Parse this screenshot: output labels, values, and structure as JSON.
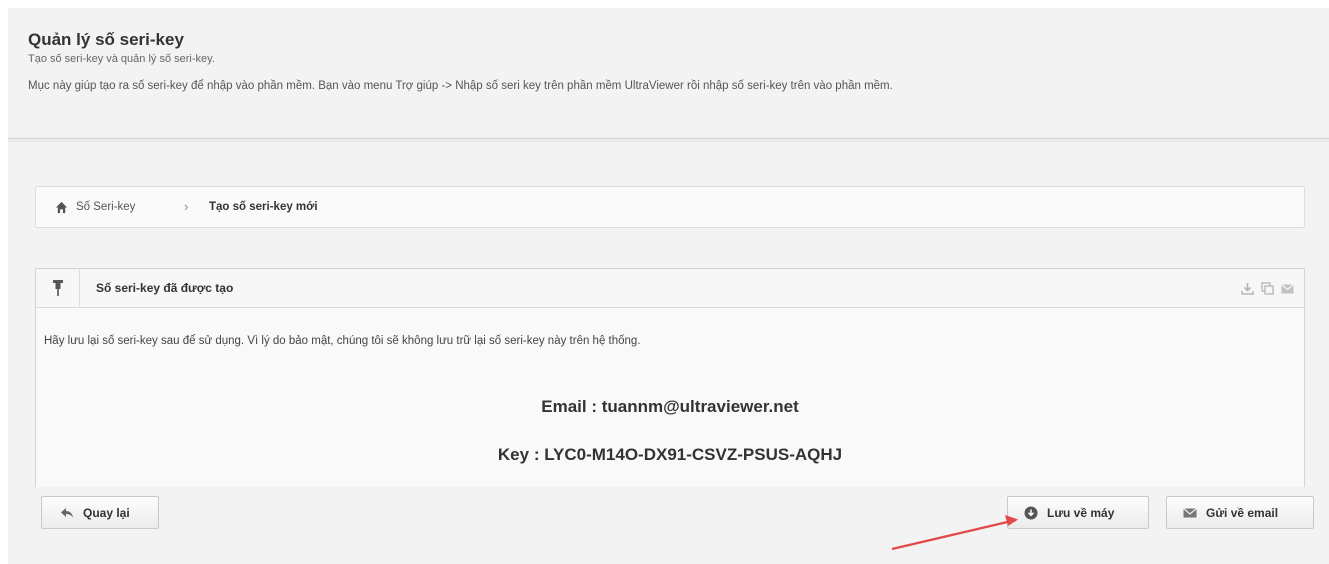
{
  "header": {
    "title": "Quản lý số seri-key",
    "subtitle": "Tạo số seri-key và quản lý số seri-key.",
    "description": "Mục này giúp tạo ra số seri-key để nhập vào phần mềm. Bạn vào menu Trợ giúp -> Nhập số seri key trên phần mềm UltraViewer rồi nhập số seri-key trên vào phần mềm."
  },
  "breadcrumb": {
    "home_icon": "home-icon",
    "item": "Số Seri-key",
    "separator": "›",
    "current": "Tạo số seri-key mới"
  },
  "widget": {
    "icon": "pin-icon",
    "title": "Số seri-key đã được tạo",
    "tools": [
      "download-icon",
      "copy-icon",
      "mail-icon"
    ],
    "notice": "Hãy lưu lại số seri-key sau để sử dụng. Vì lý do bảo mật, chúng tôi sẽ không lưu trữ lại số seri-key này trên hệ thống.",
    "email_line": "Email : tuannm@ultraviewer.net",
    "key_line": "Key : LYC0-M14O-DX91-CSVZ-PSUS-AQHJ"
  },
  "buttons": {
    "back": "Quay lại",
    "save": "Lưu về máy",
    "email": "Gửi về email"
  },
  "colors": {
    "background": "#f3f3f3",
    "annotation_arrow": "#e04a4a"
  }
}
